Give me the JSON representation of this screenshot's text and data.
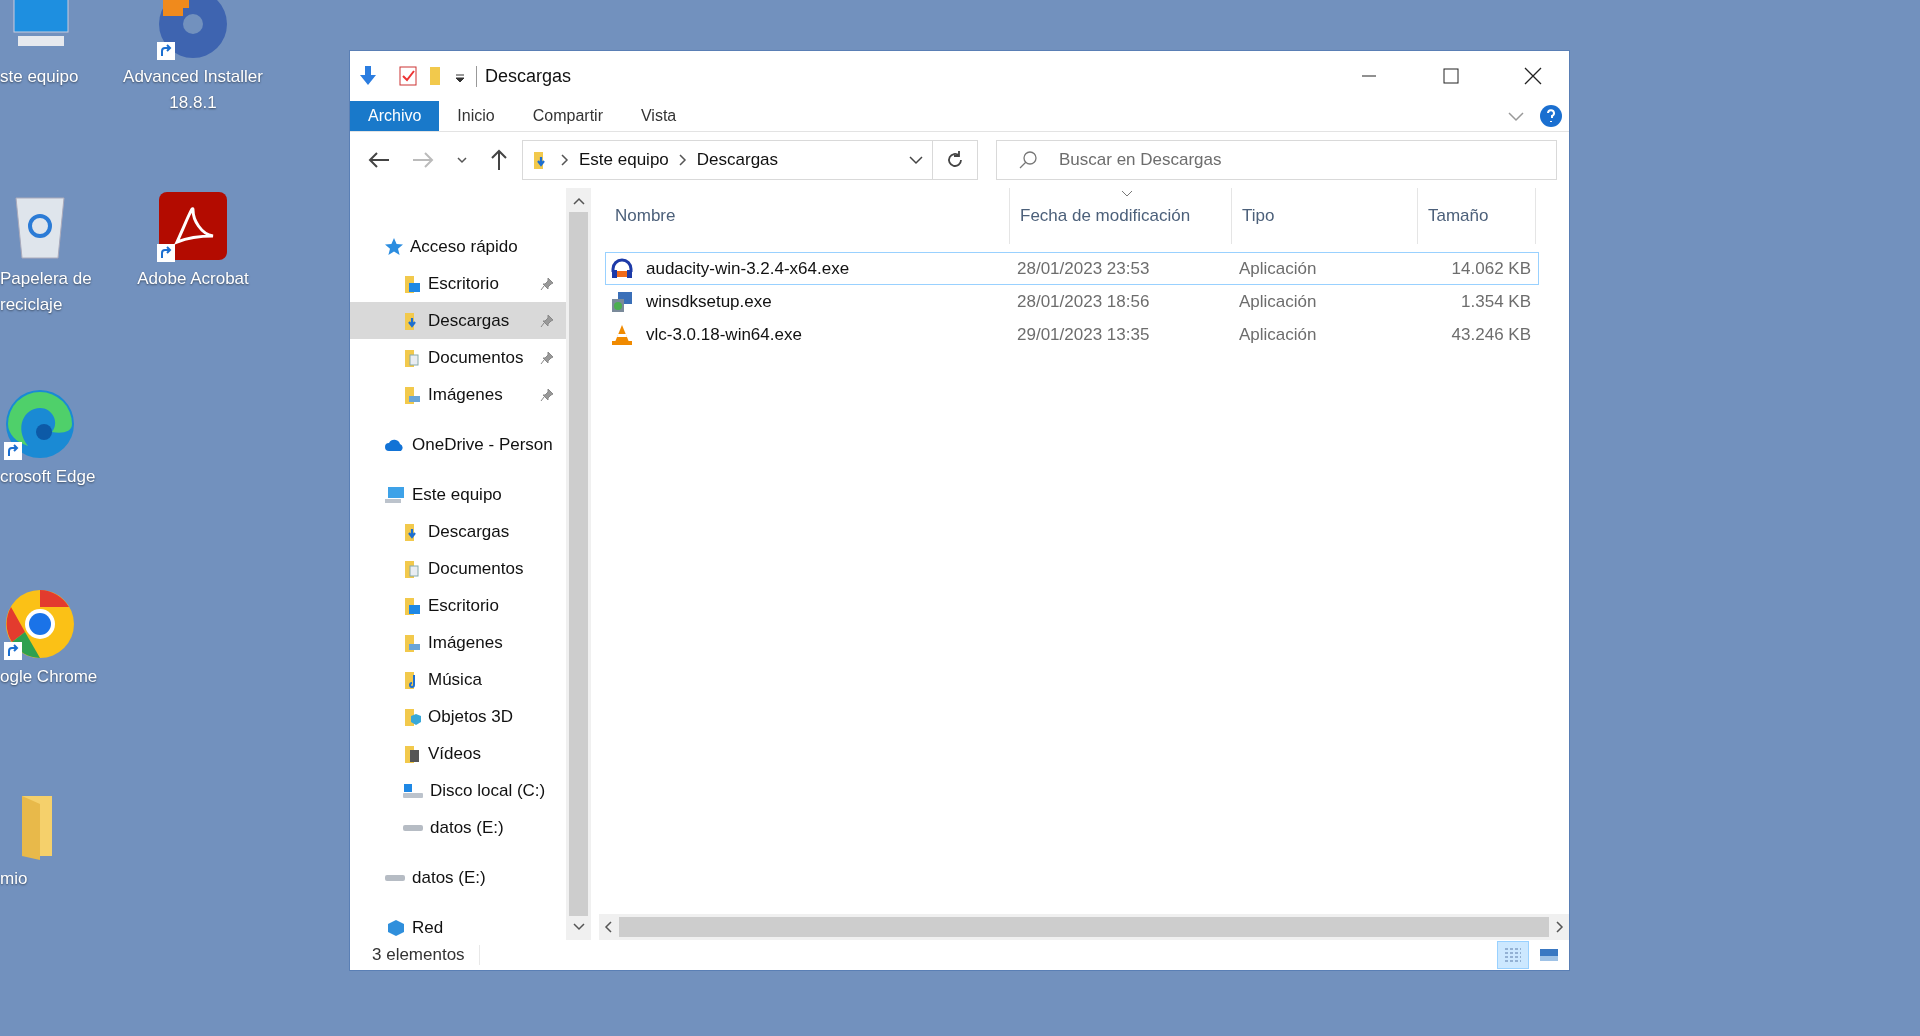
{
  "desktop_icons": [
    {
      "label": "ste equipo",
      "kind": "computer",
      "shortcut": false
    },
    {
      "label": "Advanced Installer 18.8.1",
      "kind": "installer",
      "shortcut": true
    },
    {
      "label": "Papelera de reciclaje",
      "kind": "recycle",
      "shortcut": false
    },
    {
      "label": "Adobe Acrobat",
      "kind": "acrobat",
      "shortcut": true
    },
    {
      "label": "crosoft Edge",
      "kind": "edge",
      "shortcut": true
    },
    {
      "label": "ogle Chrome",
      "kind": "chrome",
      "shortcut": true
    },
    {
      "label": "mio",
      "kind": "folder",
      "shortcut": false
    }
  ],
  "window": {
    "title": "Descargas",
    "ribbon_tabs": [
      {
        "label": "Archivo",
        "selected": true
      },
      {
        "label": "Inicio",
        "selected": false
      },
      {
        "label": "Compartir",
        "selected": false
      },
      {
        "label": "Vista",
        "selected": false
      }
    ],
    "address": {
      "crumbs": [
        "Este equipo",
        "Descargas"
      ]
    },
    "search": {
      "placeholder": "Buscar en Descargas"
    },
    "sidebar": {
      "items": [
        {
          "label": "Acceso rápido",
          "kind": "star",
          "selected": false,
          "children": [
            {
              "label": "Escritorio",
              "kind": "desktop",
              "selected": false,
              "pinned": true
            },
            {
              "label": "Descargas",
              "kind": "downloads",
              "selected": true,
              "pinned": true
            },
            {
              "label": "Documentos",
              "kind": "documents",
              "selected": false,
              "pinned": true
            },
            {
              "label": "Imágenes",
              "kind": "pictures",
              "selected": false,
              "pinned": true
            }
          ]
        },
        {
          "label": "OneDrive - Person",
          "kind": "cloud",
          "selected": false
        },
        {
          "label": "Este equipo",
          "kind": "computer",
          "selected": false,
          "children": [
            {
              "label": "Descargas",
              "kind": "downloads",
              "selected": false
            },
            {
              "label": "Documentos",
              "kind": "documents",
              "selected": false
            },
            {
              "label": "Escritorio",
              "kind": "desktop",
              "selected": false
            },
            {
              "label": "Imágenes",
              "kind": "pictures",
              "selected": false
            },
            {
              "label": "Música",
              "kind": "music",
              "selected": false
            },
            {
              "label": "Objetos 3D",
              "kind": "objects",
              "selected": false
            },
            {
              "label": "Vídeos",
              "kind": "videos",
              "selected": false
            },
            {
              "label": "Disco local (C:)",
              "kind": "system-drive",
              "selected": false
            },
            {
              "label": "datos (E:)",
              "kind": "drive",
              "selected": false
            }
          ]
        },
        {
          "label": "datos (E:)",
          "kind": "drive",
          "selected": false
        },
        {
          "label": "Red",
          "kind": "network",
          "selected": false
        }
      ]
    },
    "table": {
      "columns": [
        {
          "label": "Nombre",
          "sorted": false
        },
        {
          "label": "Fecha de modificación",
          "sorted": true
        },
        {
          "label": "Tipo",
          "sorted": false
        },
        {
          "label": "Tamaño",
          "sorted": false
        }
      ],
      "rows": [
        {
          "name": "audacity-win-3.2.4-x64.exe",
          "date": "28/01/2023 23:53",
          "type": "Aplicación",
          "size": "14.062 KB",
          "kind": "headphones",
          "selected": true
        },
        {
          "name": "winsdksetup.exe",
          "date": "28/01/2023 18:56",
          "type": "Aplicación",
          "size": "1.354 KB",
          "kind": "setup",
          "selected": false
        },
        {
          "name": "vlc-3.0.18-win64.exe",
          "date": "29/01/2023 13:35",
          "type": "Aplicación",
          "size": "43.246 KB",
          "kind": "cone",
          "selected": false
        }
      ]
    },
    "status_bar": {
      "count": "3 elementos"
    }
  }
}
